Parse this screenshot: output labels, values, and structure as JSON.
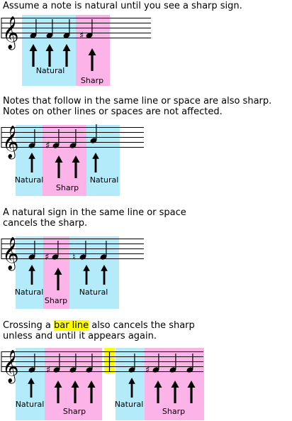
{
  "panels": [
    {
      "caption_lines": [
        "Assume a note is natural until you see a sharp sign."
      ],
      "labels": [
        "Natural",
        "Sharp"
      ]
    },
    {
      "caption_lines": [
        "Notes that follow in the same line or space are also sharp.",
        "Notes on other lines or spaces are not affected."
      ],
      "labels": [
        "Natural",
        "Sharp",
        "Natural"
      ]
    },
    {
      "caption_lines": [
        "A natural sign in the same line or space",
        "cancels the sharp."
      ],
      "labels": [
        "Natural",
        "Sharp",
        "Natural"
      ]
    },
    {
      "caption_pre": "Crossing a ",
      "caption_highlight": "bar line",
      "caption_post": " also cancels the sharp",
      "caption_line2": "unless and until it appears again.",
      "labels": [
        "Natural",
        "Sharp",
        "Natural",
        "Sharp"
      ]
    }
  ],
  "colors": {
    "natural_region": "#b3ebfb",
    "sharp_region": "#fcb3e8",
    "bar_highlight": "#ffff00",
    "staff_lines": "#000000"
  },
  "symbols": {
    "treble_clef": "𝄞",
    "sharp_sign": "♯",
    "natural_sign": "♮"
  }
}
